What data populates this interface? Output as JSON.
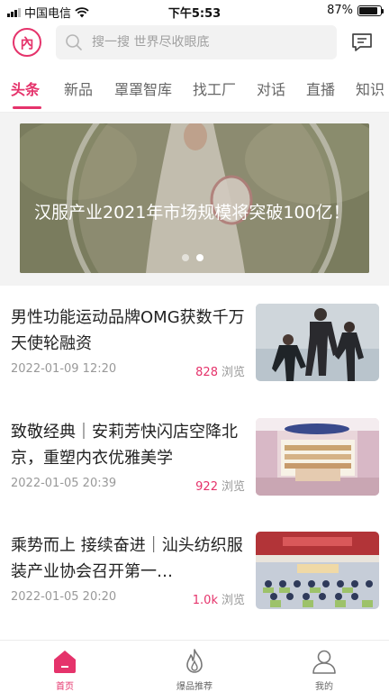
{
  "status_bar": {
    "carrier": "中国电信",
    "time": "下午5:53",
    "battery_text": "87%",
    "battery_level": 0.87
  },
  "header": {
    "logo_text": "內",
    "search_placeholder": "搜一搜 世界尽收眼底",
    "search_icon": "search-icon",
    "message_icon": "message-icon"
  },
  "tabs": [
    {
      "label": "头条",
      "active": true
    },
    {
      "label": "新品",
      "active": false
    },
    {
      "label": "罩罩智库",
      "active": false
    },
    {
      "label": "找工厂",
      "active": false
    },
    {
      "label": "对话",
      "active": false
    },
    {
      "label": "直播",
      "active": false
    },
    {
      "label": "知识",
      "active": false
    }
  ],
  "banner": {
    "title": "汉服产业2021年市场规模将突破100亿！",
    "slide_count": 2,
    "current_slide": 2
  },
  "news": [
    {
      "title": "男性功能运动品牌OMG获数千万天使轮融资",
      "date": "2022-01-09 12:20",
      "views": "828",
      "views_label": "浏览"
    },
    {
      "title": "致敬经典｜安莉芳快闪店空降北京，重塑内衣优雅美学",
      "date": "2022-01-05 20:39",
      "views": "922",
      "views_label": "浏览"
    },
    {
      "title": "乘势而上 接续奋进｜汕头纺织服装产业协会召开第一…",
      "date": "2022-01-05 20:20",
      "views": "1.0k",
      "views_label": "浏览"
    }
  ],
  "bottom_nav": [
    {
      "label": "首页",
      "icon": "home-icon",
      "active": true
    },
    {
      "label": "爆品推荐",
      "icon": "flame-icon",
      "active": false
    },
    {
      "label": "我的",
      "icon": "user-icon",
      "active": false
    }
  ],
  "colors": {
    "accent": "#e5336b",
    "text_primary": "#222222",
    "text_secondary": "#999999"
  }
}
